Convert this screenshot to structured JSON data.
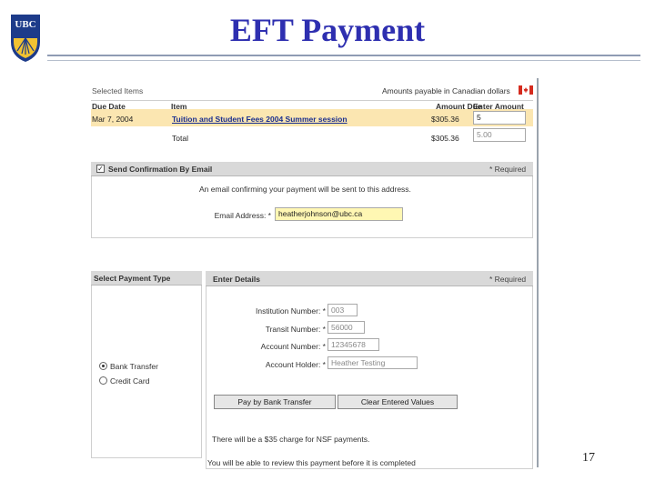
{
  "slide": {
    "title": "EFT Payment",
    "logo_text": "UBC",
    "page_number": "17"
  },
  "items": {
    "section_title": "Selected Items",
    "currency_note": "Amounts payable in Canadian dollars",
    "columns": [
      "Due Date",
      "Item",
      "Amount Due",
      "Enter Amount"
    ],
    "row": {
      "due_date": "Mar 7, 2004",
      "item": "Tuition and Student Fees 2004 Summer session",
      "amount_due": "$305.36",
      "enter_amount": "5"
    },
    "total": {
      "label": "Total",
      "amount_due": "$305.36",
      "enter_amount": "5.00"
    }
  },
  "confirmation": {
    "title": "Send Confirmation By Email",
    "required_note": "* Required",
    "description": "An email confirming your payment will be sent to this address.",
    "email_label": "Email Address: *",
    "email_value": "heatherjohnson@ubc.ca"
  },
  "payment_type": {
    "title": "Select Payment Type",
    "options": [
      "Bank Transfer",
      "Credit Card"
    ],
    "selected": "Bank Transfer"
  },
  "details": {
    "title": "Enter Details",
    "required_note": "* Required",
    "fields": [
      {
        "label": "Institution Number: *",
        "value": "003"
      },
      {
        "label": "Transit Number: *",
        "value": "56000"
      },
      {
        "label": "Account Number: *",
        "value": "12345678"
      },
      {
        "label": "Account Holder: *",
        "value": "Heather Testing"
      }
    ],
    "pay_button": "Pay by Bank Transfer",
    "clear_button": "Clear Entered Values",
    "nsf_note": "There will be a $35 charge for NSF payments.",
    "review_note": "You will be able to review this payment before it is completed"
  },
  "colors": {
    "title_blue": "#2e2fb0",
    "row_highlight": "#fbe6b1",
    "email_highlight": "#fff7b3",
    "header_gray": "#d9d9d9"
  }
}
